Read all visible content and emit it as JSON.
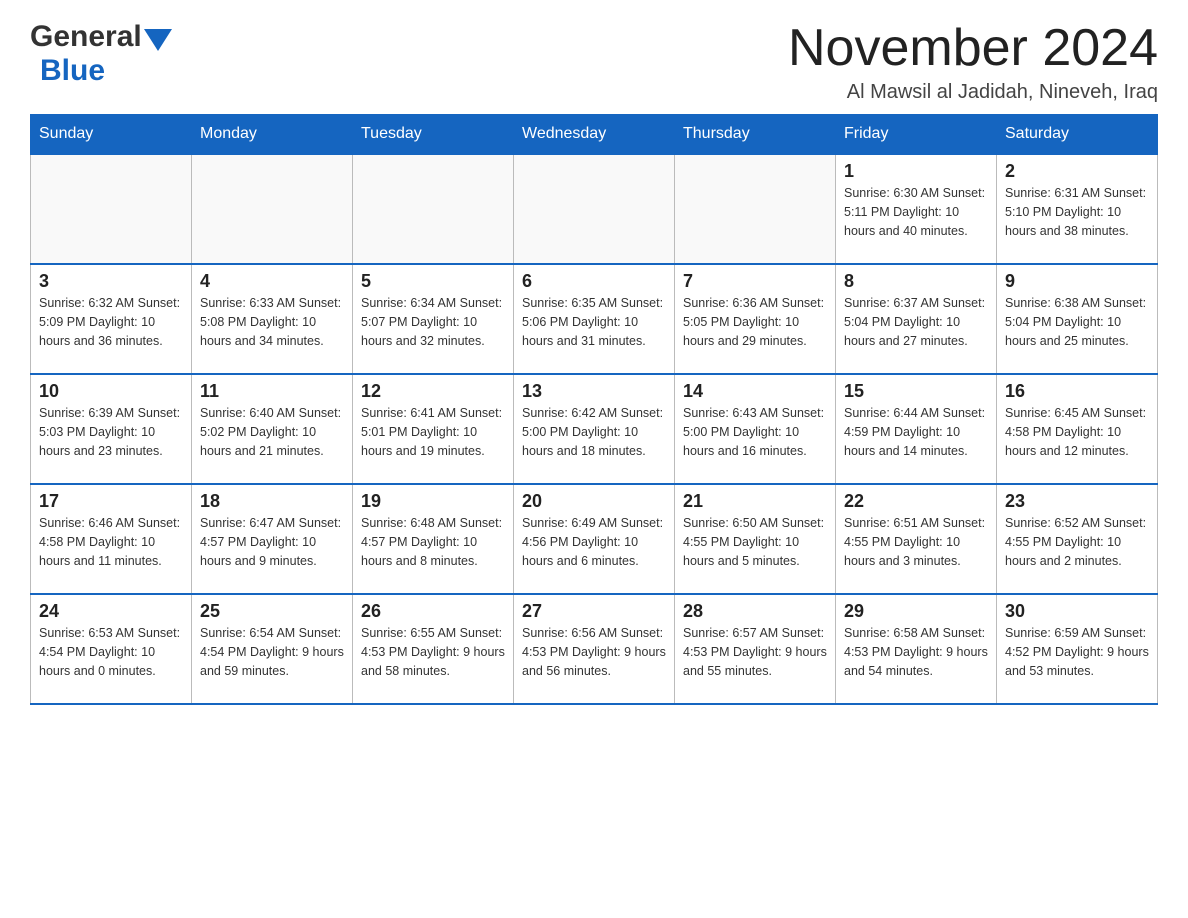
{
  "header": {
    "logo_general": "General",
    "logo_blue": "Blue",
    "month_title": "November 2024",
    "location": "Al Mawsil al Jadidah, Nineveh, Iraq"
  },
  "days_of_week": [
    "Sunday",
    "Monday",
    "Tuesday",
    "Wednesday",
    "Thursday",
    "Friday",
    "Saturday"
  ],
  "weeks": [
    [
      {
        "day": "",
        "info": ""
      },
      {
        "day": "",
        "info": ""
      },
      {
        "day": "",
        "info": ""
      },
      {
        "day": "",
        "info": ""
      },
      {
        "day": "",
        "info": ""
      },
      {
        "day": "1",
        "info": "Sunrise: 6:30 AM\nSunset: 5:11 PM\nDaylight: 10 hours and 40 minutes."
      },
      {
        "day": "2",
        "info": "Sunrise: 6:31 AM\nSunset: 5:10 PM\nDaylight: 10 hours and 38 minutes."
      }
    ],
    [
      {
        "day": "3",
        "info": "Sunrise: 6:32 AM\nSunset: 5:09 PM\nDaylight: 10 hours and 36 minutes."
      },
      {
        "day": "4",
        "info": "Sunrise: 6:33 AM\nSunset: 5:08 PM\nDaylight: 10 hours and 34 minutes."
      },
      {
        "day": "5",
        "info": "Sunrise: 6:34 AM\nSunset: 5:07 PM\nDaylight: 10 hours and 32 minutes."
      },
      {
        "day": "6",
        "info": "Sunrise: 6:35 AM\nSunset: 5:06 PM\nDaylight: 10 hours and 31 minutes."
      },
      {
        "day": "7",
        "info": "Sunrise: 6:36 AM\nSunset: 5:05 PM\nDaylight: 10 hours and 29 minutes."
      },
      {
        "day": "8",
        "info": "Sunrise: 6:37 AM\nSunset: 5:04 PM\nDaylight: 10 hours and 27 minutes."
      },
      {
        "day": "9",
        "info": "Sunrise: 6:38 AM\nSunset: 5:04 PM\nDaylight: 10 hours and 25 minutes."
      }
    ],
    [
      {
        "day": "10",
        "info": "Sunrise: 6:39 AM\nSunset: 5:03 PM\nDaylight: 10 hours and 23 minutes."
      },
      {
        "day": "11",
        "info": "Sunrise: 6:40 AM\nSunset: 5:02 PM\nDaylight: 10 hours and 21 minutes."
      },
      {
        "day": "12",
        "info": "Sunrise: 6:41 AM\nSunset: 5:01 PM\nDaylight: 10 hours and 19 minutes."
      },
      {
        "day": "13",
        "info": "Sunrise: 6:42 AM\nSunset: 5:00 PM\nDaylight: 10 hours and 18 minutes."
      },
      {
        "day": "14",
        "info": "Sunrise: 6:43 AM\nSunset: 5:00 PM\nDaylight: 10 hours and 16 minutes."
      },
      {
        "day": "15",
        "info": "Sunrise: 6:44 AM\nSunset: 4:59 PM\nDaylight: 10 hours and 14 minutes."
      },
      {
        "day": "16",
        "info": "Sunrise: 6:45 AM\nSunset: 4:58 PM\nDaylight: 10 hours and 12 minutes."
      }
    ],
    [
      {
        "day": "17",
        "info": "Sunrise: 6:46 AM\nSunset: 4:58 PM\nDaylight: 10 hours and 11 minutes."
      },
      {
        "day": "18",
        "info": "Sunrise: 6:47 AM\nSunset: 4:57 PM\nDaylight: 10 hours and 9 minutes."
      },
      {
        "day": "19",
        "info": "Sunrise: 6:48 AM\nSunset: 4:57 PM\nDaylight: 10 hours and 8 minutes."
      },
      {
        "day": "20",
        "info": "Sunrise: 6:49 AM\nSunset: 4:56 PM\nDaylight: 10 hours and 6 minutes."
      },
      {
        "day": "21",
        "info": "Sunrise: 6:50 AM\nSunset: 4:55 PM\nDaylight: 10 hours and 5 minutes."
      },
      {
        "day": "22",
        "info": "Sunrise: 6:51 AM\nSunset: 4:55 PM\nDaylight: 10 hours and 3 minutes."
      },
      {
        "day": "23",
        "info": "Sunrise: 6:52 AM\nSunset: 4:55 PM\nDaylight: 10 hours and 2 minutes."
      }
    ],
    [
      {
        "day": "24",
        "info": "Sunrise: 6:53 AM\nSunset: 4:54 PM\nDaylight: 10 hours and 0 minutes."
      },
      {
        "day": "25",
        "info": "Sunrise: 6:54 AM\nSunset: 4:54 PM\nDaylight: 9 hours and 59 minutes."
      },
      {
        "day": "26",
        "info": "Sunrise: 6:55 AM\nSunset: 4:53 PM\nDaylight: 9 hours and 58 minutes."
      },
      {
        "day": "27",
        "info": "Sunrise: 6:56 AM\nSunset: 4:53 PM\nDaylight: 9 hours and 56 minutes."
      },
      {
        "day": "28",
        "info": "Sunrise: 6:57 AM\nSunset: 4:53 PM\nDaylight: 9 hours and 55 minutes."
      },
      {
        "day": "29",
        "info": "Sunrise: 6:58 AM\nSunset: 4:53 PM\nDaylight: 9 hours and 54 minutes."
      },
      {
        "day": "30",
        "info": "Sunrise: 6:59 AM\nSunset: 4:52 PM\nDaylight: 9 hours and 53 minutes."
      }
    ]
  ]
}
